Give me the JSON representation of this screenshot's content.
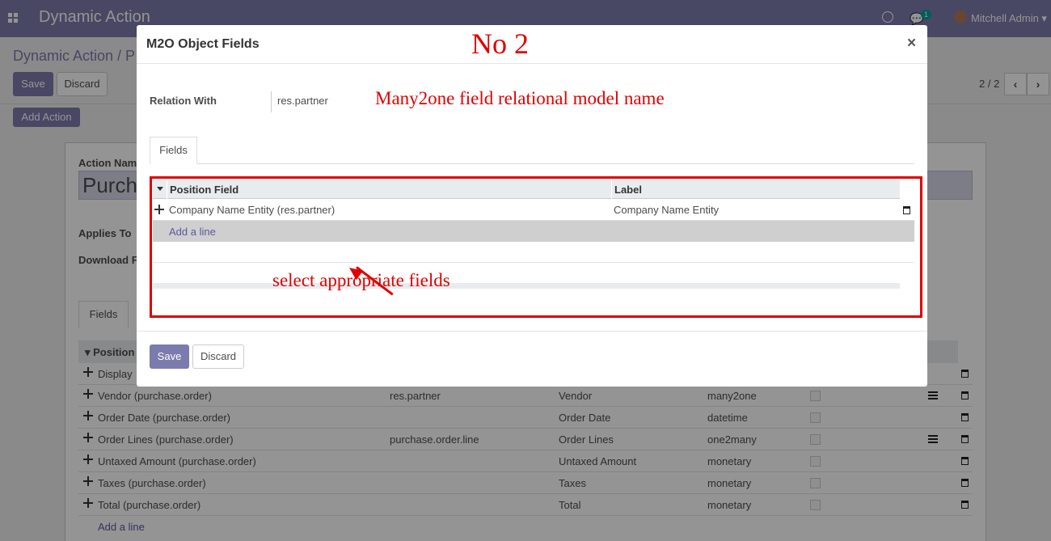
{
  "navbar": {
    "app_title": "Dynamic Action",
    "chat_badge": "1",
    "user_name": "Mitchell Admin"
  },
  "control_panel": {
    "breadcrumb": "Dynamic Action / P",
    "save_label": "Save",
    "discard_label": "Discard",
    "add_action_label": "Add Action",
    "pager": "2 / 2"
  },
  "form": {
    "action_name_label": "Action Nam",
    "action_name_value": "Purch",
    "applies_to_label": "Applies To",
    "download_label": "Download F",
    "tab_label": "Fields",
    "table_header": "Position",
    "rows": [
      {
        "field": "Display",
        "relation": "",
        "label": "",
        "type": "",
        "list_icon": false
      },
      {
        "field": "Vendor (purchase.order)",
        "relation": "res.partner",
        "label": "Vendor",
        "type": "many2one",
        "list_icon": true
      },
      {
        "field": "Order Date (purchase.order)",
        "relation": "",
        "label": "Order Date",
        "type": "datetime",
        "list_icon": false
      },
      {
        "field": "Order Lines (purchase.order)",
        "relation": "purchase.order.line",
        "label": "Order Lines",
        "type": "one2many",
        "list_icon": true
      },
      {
        "field": "Untaxed Amount (purchase.order)",
        "relation": "",
        "label": "Untaxed Amount",
        "type": "monetary",
        "list_icon": false
      },
      {
        "field": "Taxes (purchase.order)",
        "relation": "",
        "label": "Taxes",
        "type": "monetary",
        "list_icon": false
      },
      {
        "field": "Total (purchase.order)",
        "relation": "",
        "label": "Total",
        "type": "monetary",
        "list_icon": false
      }
    ],
    "add_line": "Add a line"
  },
  "modal": {
    "title": "M2O Object Fields",
    "close_glyph": "×",
    "relation_label": "Relation With",
    "relation_value": "res.partner",
    "tab_label": "Fields",
    "col_position_field": "Position Field",
    "col_label": "Label",
    "row_field": "Company Name Entity (res.partner)",
    "row_label": "Company Name Entity",
    "add_line": "Add a line",
    "save_label": "Save",
    "discard_label": "Discard"
  },
  "annotations": {
    "step": "No 2",
    "relation_note": "Many2one field relational model name",
    "fields_note": "select appropriate fields"
  },
  "colors": {
    "brand": "#7c7bad",
    "annotation": "#e00000"
  }
}
